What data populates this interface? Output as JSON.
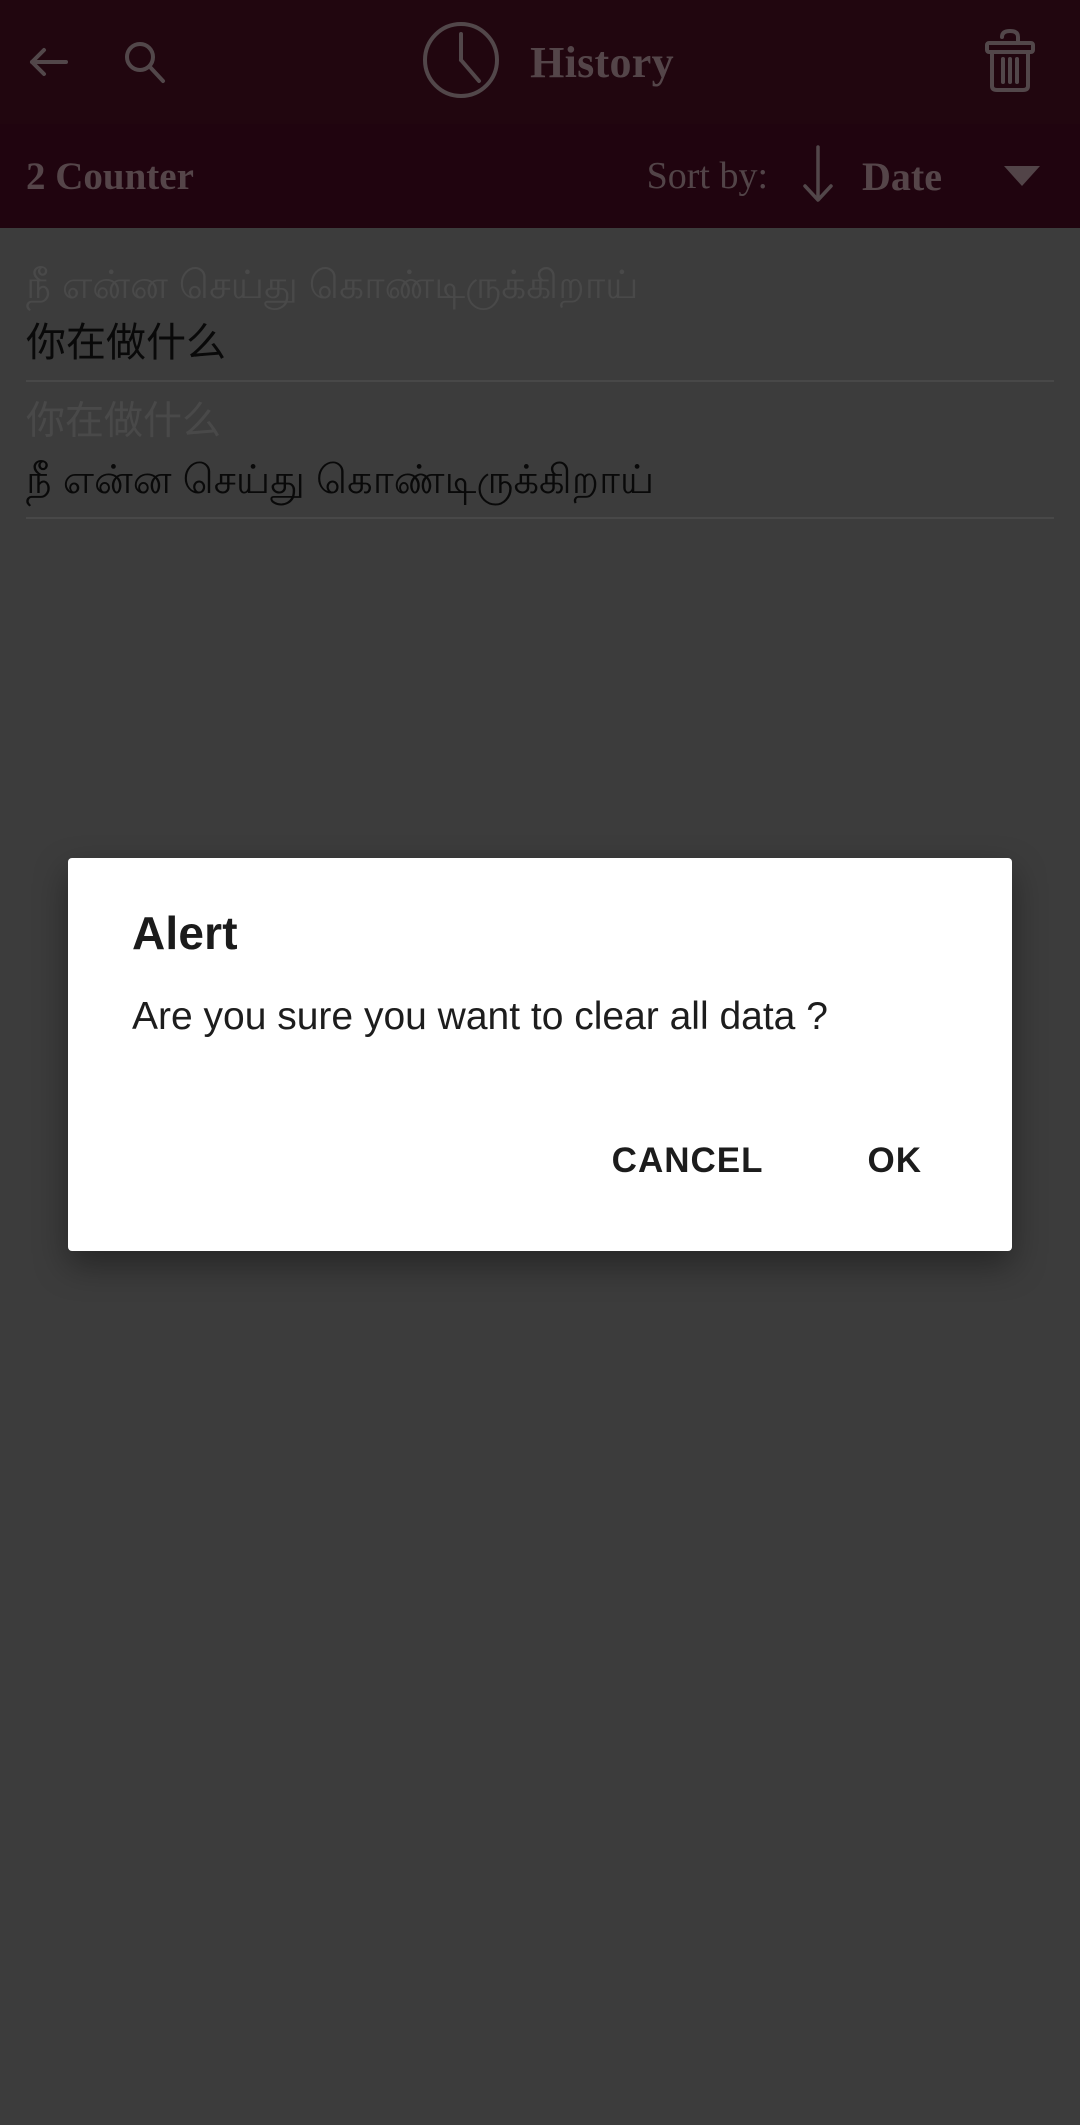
{
  "appbar": {
    "back_icon": "arrow-left-icon",
    "search_icon": "search-icon",
    "clock_icon": "clock-icon",
    "title": "History",
    "delete_icon": "trash-icon",
    "background_color": "#3a0c1b",
    "foreground_color": "#8d7a80"
  },
  "sortbar": {
    "counter_label": "2 Counter",
    "sort_by_label": "Sort by:",
    "sort_direction_icon": "arrow-down-icon",
    "sort_value": "Date",
    "dropdown_icon": "caret-down-icon",
    "background_color": "#37081a"
  },
  "history": {
    "items": [
      {
        "source_text": "நீ என்ன செய்து கொண்டிருக்கிறாய்",
        "target_text": "你在做什么"
      },
      {
        "source_text": "你在做什么",
        "target_text": "நீ என்ன செய்து கொண்டிருக்கிறாய்"
      }
    ]
  },
  "dialog": {
    "title": "Alert",
    "message": "Are you sure you want to clear all data ?",
    "cancel_label": "CANCEL",
    "ok_label": "OK",
    "background_color": "#ffffff"
  }
}
